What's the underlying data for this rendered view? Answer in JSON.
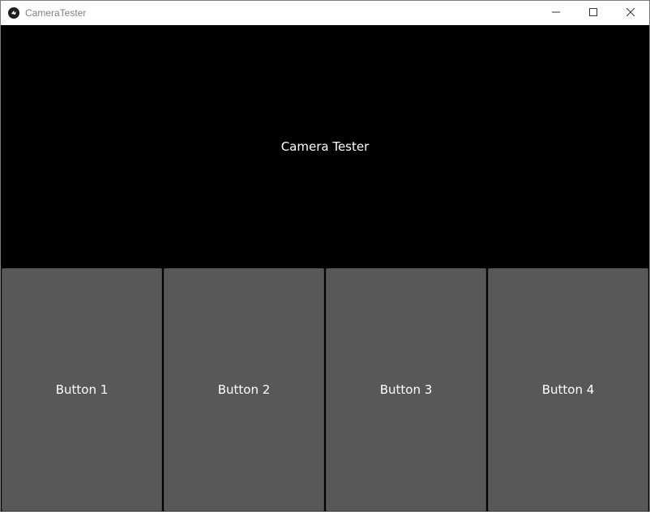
{
  "window": {
    "title": "CameraTester"
  },
  "main": {
    "label": "Camera Tester"
  },
  "buttons": [
    {
      "label": "Button 1"
    },
    {
      "label": "Button 2"
    },
    {
      "label": "Button 3"
    },
    {
      "label": "Button 4"
    }
  ],
  "icons": {
    "app": "kivy-app-icon",
    "minimize": "minimize-icon",
    "maximize": "maximize-icon",
    "close": "close-icon"
  },
  "colors": {
    "background": "#000000",
    "button": "#585858",
    "text": "#ffffff"
  }
}
